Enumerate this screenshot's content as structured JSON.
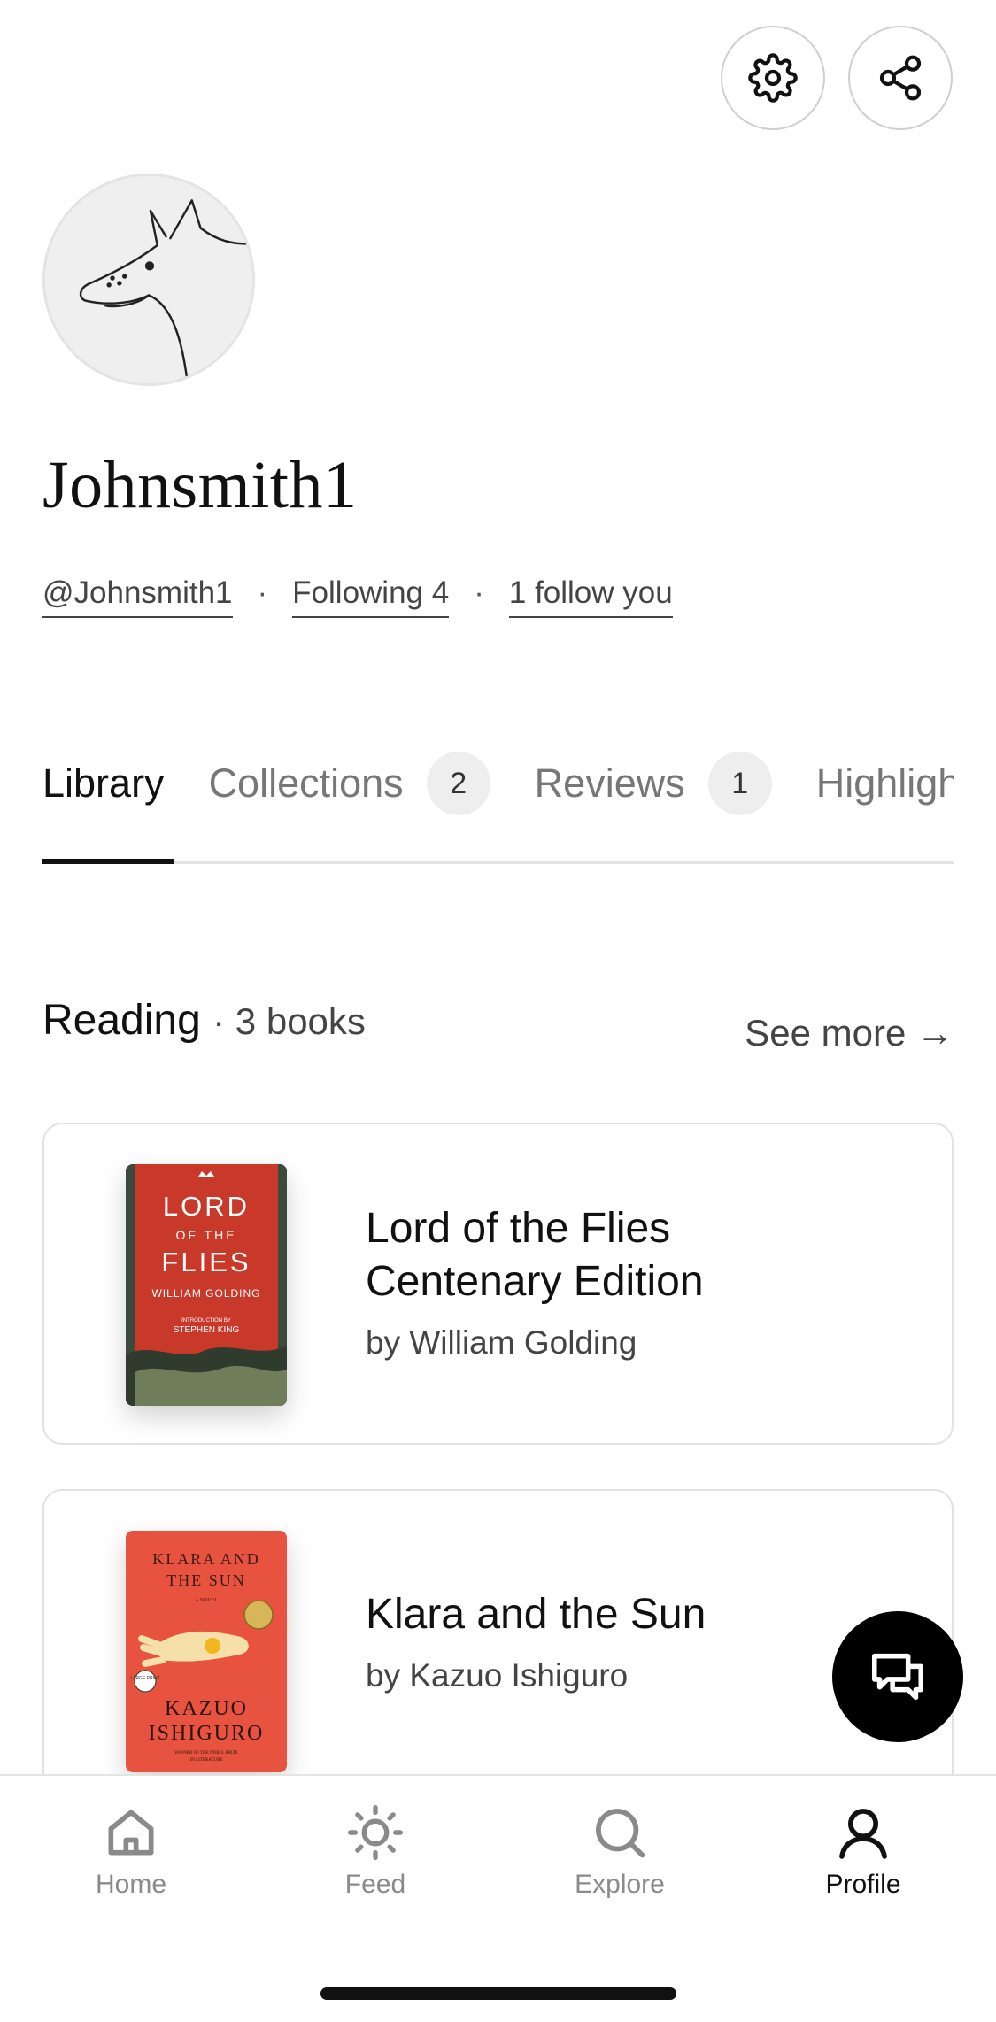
{
  "header": {
    "settings_icon": "gear-icon",
    "share_icon": "share-icon"
  },
  "profile": {
    "display_name": "Johnsmith1",
    "handle": "@Johnsmith1",
    "following": "Following 4",
    "followers": "1 follow you"
  },
  "tabs": [
    {
      "label": "Library",
      "count": null,
      "active": true
    },
    {
      "label": "Collections",
      "count": "2",
      "active": false
    },
    {
      "label": "Reviews",
      "count": "1",
      "active": false
    },
    {
      "label": "Highlights",
      "count": null,
      "active": false
    }
  ],
  "section": {
    "title": "Reading",
    "count": "· 3 books",
    "see_more": "See more →"
  },
  "books": [
    {
      "title_line1": "Lord of the Flies",
      "title_line2": "Centenary Edition",
      "author": "by William Golding",
      "cover": {
        "line1": "LORD",
        "line2": "OF THE",
        "line3": "FLIES",
        "line4": "WILLIAM GOLDING",
        "line5": "INTRODUCTION BY",
        "line6": "STEPHEN KING",
        "color": "#c9392a"
      }
    },
    {
      "title_line1": "Klara and the Sun",
      "title_line2": "",
      "author": "by Kazuo Ishiguro",
      "cover": {
        "line1": "KLARA AND",
        "line2": "THE SUN",
        "line3": "A NOVEL",
        "line4": "KAZUO",
        "line5": "ISHIGURO",
        "line6": "WINNER OF THE NOBEL PRIZE",
        "line7": "IN LITERATURE",
        "badge": "LARGE PRINT",
        "color": "#e8533f"
      }
    }
  ],
  "nav": {
    "home": "Home",
    "feed": "Feed",
    "explore": "Explore",
    "profile": "Profile",
    "active": "profile"
  },
  "colors": {
    "accent": "#111111",
    "muted": "#777777",
    "badge_bg": "#eeeeee"
  }
}
